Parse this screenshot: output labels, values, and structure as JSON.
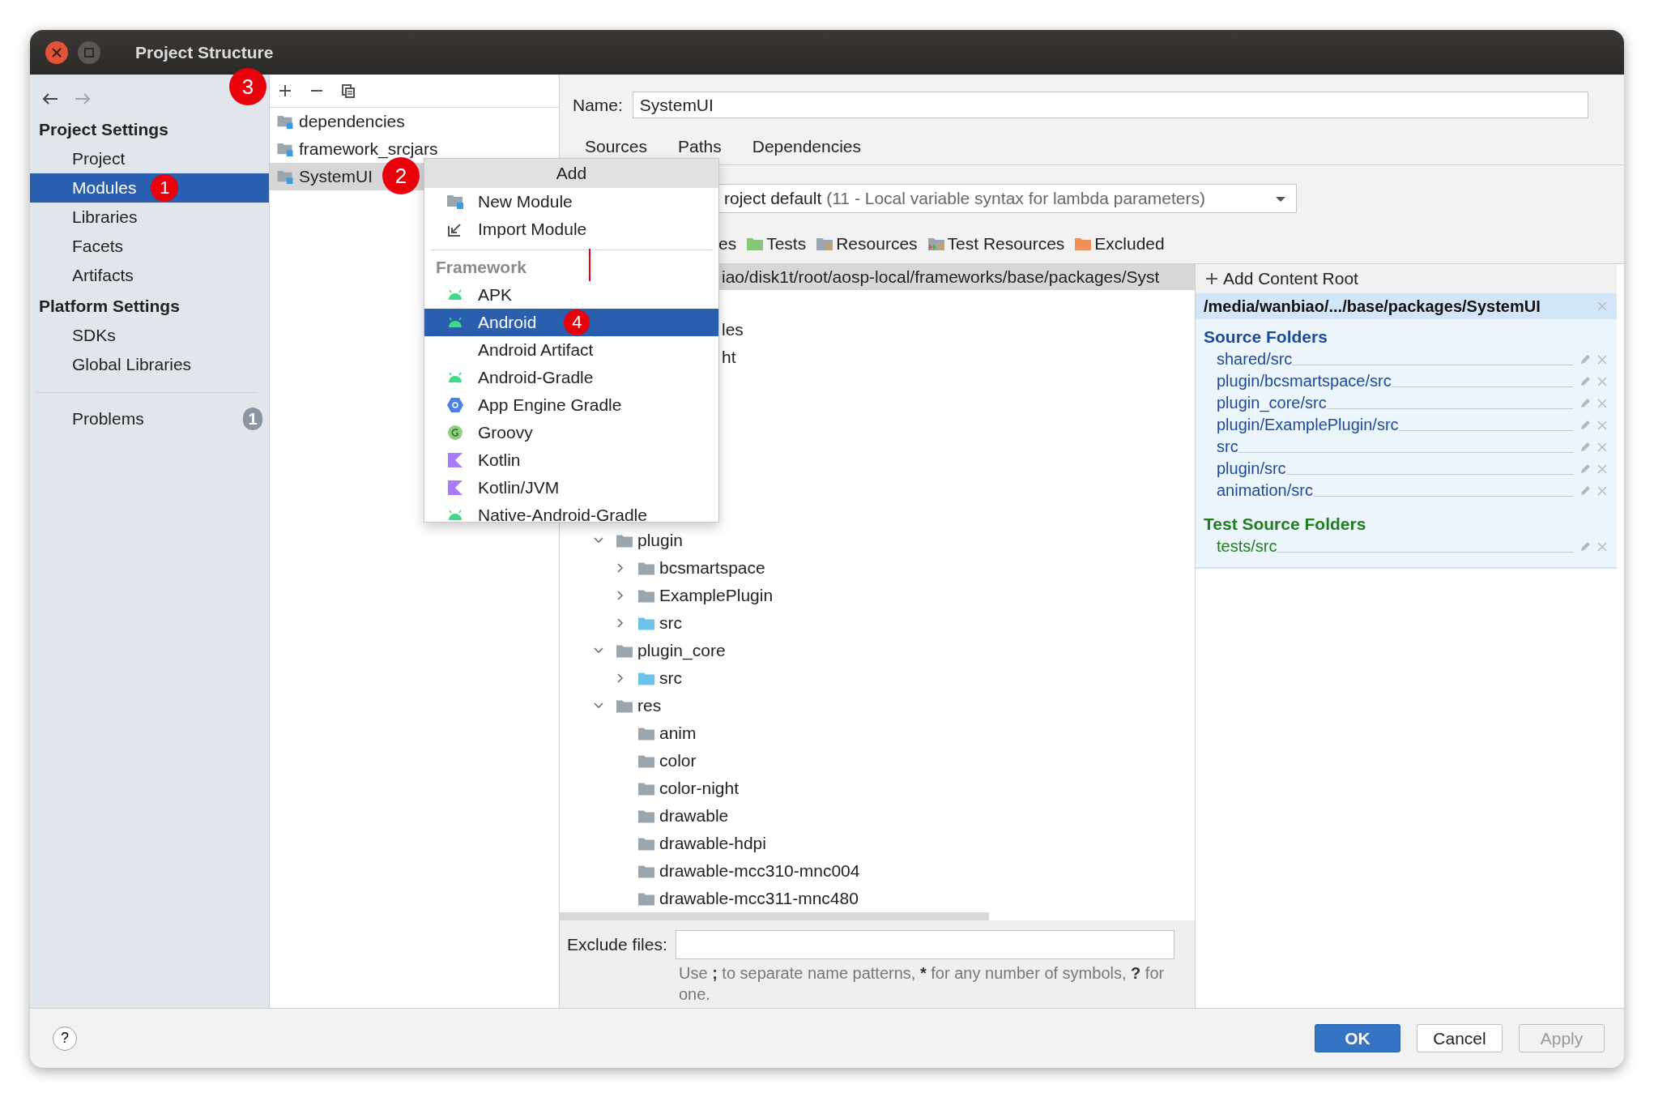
{
  "window": {
    "title": "Project Structure"
  },
  "sidebar": {
    "nav": [
      {
        "kind": "back",
        "disabled": false
      },
      {
        "kind": "forward",
        "disabled": true
      }
    ],
    "sections": [
      {
        "title": "Project Settings",
        "items": [
          {
            "label": "Project",
            "selected": false
          },
          {
            "label": "Modules",
            "selected": true,
            "badge": "1"
          },
          {
            "label": "Libraries",
            "selected": false
          },
          {
            "label": "Facets",
            "selected": false
          },
          {
            "label": "Artifacts",
            "selected": false
          }
        ]
      },
      {
        "title": "Platform Settings",
        "items": [
          {
            "label": "SDKs",
            "selected": false
          },
          {
            "label": "Global Libraries",
            "selected": false
          }
        ]
      }
    ],
    "problems": {
      "label": "Problems",
      "count": "1"
    }
  },
  "modules": {
    "toolbar": [
      {
        "kind": "add",
        "badge": "3"
      },
      {
        "kind": "remove"
      },
      {
        "kind": "copy"
      }
    ],
    "items": [
      {
        "name": "dependencies",
        "selected": false
      },
      {
        "name": "framework_srcjars",
        "selected": false
      },
      {
        "name": "SystemUI",
        "selected": true,
        "badge": "2"
      }
    ]
  },
  "detail": {
    "name_label": "Name:",
    "name_value": "SystemUI",
    "tabs": [
      {
        "label": "Sources"
      },
      {
        "label": "Paths"
      },
      {
        "label": "Dependencies"
      }
    ],
    "language_level": {
      "value": "roject default",
      "detail": "(11 - Local variable syntax for lambda parameters)"
    },
    "mark_as": [
      {
        "kind": "partial",
        "label": "es"
      },
      {
        "kind": "tests",
        "label": "Tests"
      },
      {
        "kind": "resources",
        "label": "Resources"
      },
      {
        "kind": "test_resources",
        "label": "Test Resources"
      },
      {
        "kind": "excluded",
        "label": "Excluded"
      }
    ],
    "tree": {
      "path": "iao/disk1t/root/aosp-local/frameworks/base/packages/Syst",
      "covered_rows": [
        {
          "text": "les"
        },
        {
          "text": "ht"
        }
      ],
      "nodes": [
        {
          "name": "plugin",
          "kind": "folder",
          "expanded": true,
          "children": [
            {
              "name": "bcsmartspace",
              "kind": "folder",
              "expanded": false
            },
            {
              "name": "ExamplePlugin",
              "kind": "folder",
              "expanded": false
            },
            {
              "name": "src",
              "kind": "source",
              "expanded": false
            }
          ]
        },
        {
          "name": "plugin_core",
          "kind": "folder",
          "expanded": true,
          "children": [
            {
              "name": "src",
              "kind": "source",
              "expanded": false
            }
          ]
        },
        {
          "name": "res",
          "kind": "folder",
          "expanded": true,
          "children": [
            {
              "name": "anim",
              "kind": "folder"
            },
            {
              "name": "color",
              "kind": "folder"
            },
            {
              "name": "color-night",
              "kind": "folder"
            },
            {
              "name": "drawable",
              "kind": "folder"
            },
            {
              "name": "drawable-hdpi",
              "kind": "folder"
            },
            {
              "name": "drawable-mcc310-mnc004",
              "kind": "folder"
            },
            {
              "name": "drawable-mcc311-mnc480",
              "kind": "folder"
            }
          ]
        }
      ]
    },
    "exclude": {
      "label": "Exclude files:",
      "hint": [
        {
          "text": "Use "
        },
        {
          "text": ";",
          "bold": true
        },
        {
          "text": " to separate name patterns, "
        },
        {
          "text": "*",
          "bold": true
        },
        {
          "text": " for any number of symbols, "
        },
        {
          "text": "?",
          "bold": true
        },
        {
          "text": " for one."
        }
      ]
    },
    "content_root": {
      "add_label": "Add Content Root",
      "root": "/media/wanbiao/.../base/packages/SystemUI",
      "groups": [
        {
          "kind": "source",
          "title": "Source Folders",
          "folders": [
            "shared/src",
            "plugin/bcsmartspace/src",
            "plugin_core/src",
            "plugin/ExamplePlugin/src",
            "src",
            "plugin/src",
            "animation/src"
          ]
        },
        {
          "kind": "test",
          "title": "Test Source Folders",
          "folders": [
            "tests/src"
          ]
        }
      ]
    }
  },
  "popup": {
    "title": "Add",
    "items": [
      {
        "kind": "module",
        "label": "New Module",
        "selected": false
      },
      {
        "kind": "import",
        "label": "Import Module",
        "selected": false
      },
      {
        "kind": "separator"
      },
      {
        "kind": "header",
        "label": "Framework"
      },
      {
        "kind": "android",
        "label": "APK",
        "selected": false
      },
      {
        "kind": "android",
        "label": "Android",
        "selected": true,
        "badge": "4"
      },
      {
        "kind": "plain",
        "label": "Android Artifact",
        "selected": false
      },
      {
        "kind": "android",
        "label": "Android-Gradle",
        "selected": false
      },
      {
        "kind": "appengine",
        "label": "App Engine Gradle",
        "selected": false
      },
      {
        "kind": "groovy",
        "label": "Groovy",
        "selected": false
      },
      {
        "kind": "kotlin",
        "label": "Kotlin",
        "selected": false
      },
      {
        "kind": "kotlin",
        "label": "Kotlin/JVM",
        "selected": false
      },
      {
        "kind": "android",
        "label": "Native-Android-Gradle",
        "selected": false
      }
    ]
  },
  "footer": {
    "help": "?",
    "buttons": [
      {
        "kind": "primary",
        "label": "OK",
        "disabled": false
      },
      {
        "kind": "default",
        "label": "Cancel",
        "disabled": false
      },
      {
        "kind": "default",
        "label": "Apply",
        "disabled": true
      }
    ]
  }
}
